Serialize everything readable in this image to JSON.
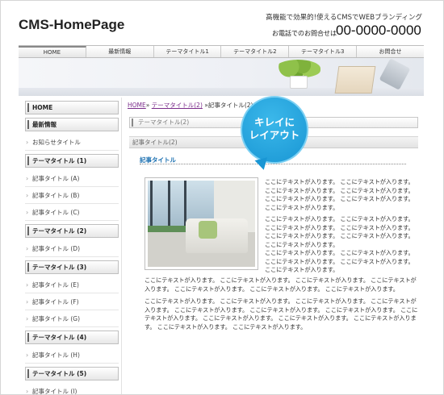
{
  "header": {
    "logo": "CMS-HomePage",
    "tagline": "高機能で効果的!使えるCMSでWEBブランディング",
    "phone_label": "お電話でのお問合せは",
    "phone": "00-0000-0000"
  },
  "nav": {
    "items": [
      "HOME",
      "最新情報",
      "テーマタイトル1",
      "テーマタイトル2",
      "テーマタイトル3",
      "お問合せ"
    ]
  },
  "sidebar": {
    "home": "HOME",
    "news": "最新情報",
    "notice": "お知らせタイトル",
    "groups": [
      {
        "title": "テーマタイトル (1)",
        "items": [
          "記事タイトル (A)",
          "記事タイトル (B)",
          "記事タイトル (C)"
        ]
      },
      {
        "title": "テーマタイトル (2)",
        "items": [
          "記事タイトル (D)"
        ]
      },
      {
        "title": "テーマタイトル (3)",
        "items": [
          "記事タイトル (E)",
          "記事タイトル (F)",
          "記事タイトル (G)"
        ]
      },
      {
        "title": "テーマタイトル (4)",
        "items": [
          "記事タイトル (H)"
        ]
      },
      {
        "title": "テーマタイトル (5)",
        "items": [
          "記事タイトル (I)"
        ]
      }
    ]
  },
  "main": {
    "breadcrumb": {
      "home": "HOME",
      "sep1": "»",
      "theme": "テーマタイトル(2)",
      "sep2": "»",
      "current": "記事タイトル(2)"
    },
    "box_title": "テーマタイトル(2)",
    "section_title": "記事タイトル(2)",
    "article_title": "記事タイトル",
    "para1": "ここにテキストが入ります。 ここにテキストが入ります。 ここにテキストが入ります。 ここにテキストが入ります。 ここにテキストが入ります。 ここにテキストが入ります。 ここにテキストが入ります。",
    "para2": "ここにテキストが入ります。 ここにテキストが入ります。 ここにテキストが入ります。 ここにテキストが入ります。 ここにテキストが入ります。 ここにテキストが入ります。 ここにテキストが入ります。",
    "para3": "ここにテキストが入ります。 ここにテキストが入ります。 ここにテキストが入ります。 ここにテキストが入ります。 ここにテキストが入ります。",
    "para4": "ここにテキストが入ります。 ここにテキストが入ります。 ここにテキストが入ります。 ここにテキストが入ります。 ここにテキストが入ります。 ここにテキストが入ります。 ここにテキストが入ります。",
    "para5": "ここにテキストが入ります。 ここにテキストが入ります。 ここにテキストが入ります。 ここにテキストが入ります。 ここにテキストが入ります。 ここにテキストが入ります。 ここにテキストが入ります。 ここにテキストが入ります。 ここにテキストが入ります。 ここにテキストが入ります。 ここにテキストが入ります。 ここにテキストが入ります。 ここにテキストが入ります。"
  },
  "bubble": {
    "line1": "キレイに",
    "line2": "レイアウト"
  }
}
